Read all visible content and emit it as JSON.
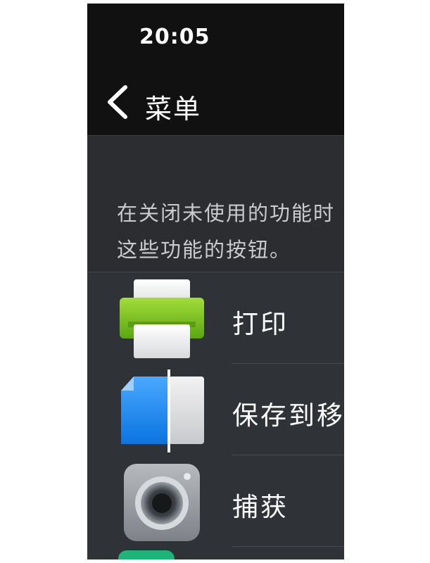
{
  "status_bar": {
    "time": "20:05"
  },
  "nav": {
    "title": "菜单",
    "back_icon": "chevron-left-icon"
  },
  "description": {
    "line1": "在关闭未使用的功能时",
    "line2": "这些功能的按钮。"
  },
  "menu": {
    "items": [
      {
        "label": "打印",
        "icon": "printer-icon"
      },
      {
        "label": "保存到移动设备",
        "icon": "save-to-mobile-icon"
      },
      {
        "label": "捕获",
        "icon": "camera-icon"
      }
    ]
  },
  "colors": {
    "background": "#2f3237",
    "header": "#111111",
    "text": "#ffffff",
    "secondary_text": "#c9cbcf",
    "printer_green": "#7bc51b",
    "file_blue": "#1f8ff0"
  }
}
